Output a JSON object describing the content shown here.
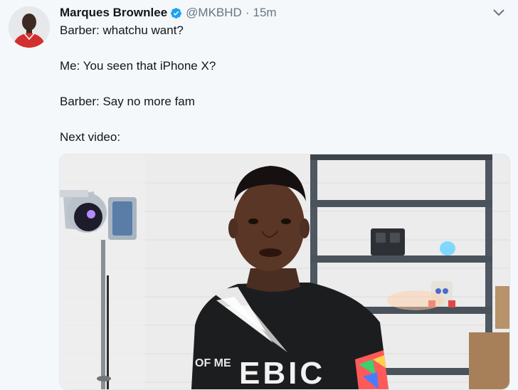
{
  "tweet": {
    "author_name": "Marques Brownlee",
    "handle": "@MKBHD",
    "separator": "·",
    "timestamp": "15m",
    "lines": [
      "Barber: whatchu want?",
      "Me: You seen that iPhone X?",
      "Barber: Say no more fam",
      "Next video:"
    ]
  },
  "media": {
    "shirt_text": "EBIC",
    "sleeve_text": "OF ME"
  },
  "icons": {
    "verified": "verified-badge-icon",
    "caret": "chevron-down-icon"
  },
  "colors": {
    "verified_blue": "#1da1f2",
    "secondary_text": "#657786",
    "background": "#f5f8fa"
  }
}
